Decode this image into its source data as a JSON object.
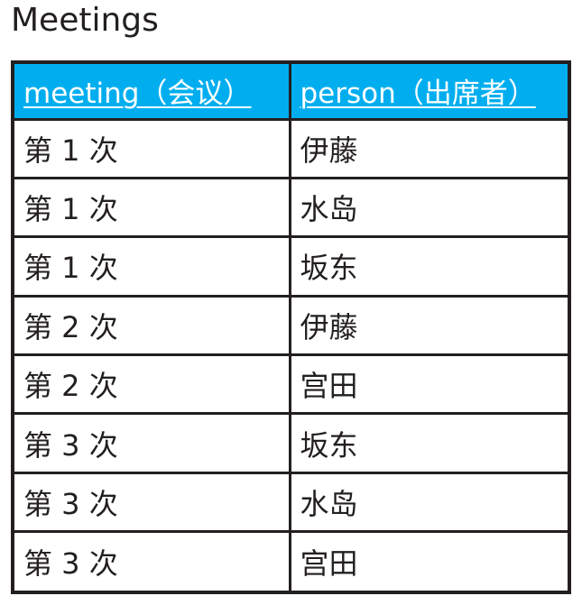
{
  "page": {
    "title": "Meetings"
  },
  "table": {
    "headers": [
      "meeting（会议）",
      "person（出席者）"
    ],
    "rows": [
      [
        "第 1 次",
        "伊藤"
      ],
      [
        "第 1 次",
        "水岛"
      ],
      [
        "第 1 次",
        "坂东"
      ],
      [
        "第 2 次",
        "伊藤"
      ],
      [
        "第 2 次",
        "宫田"
      ],
      [
        "第 3 次",
        "坂东"
      ],
      [
        "第 3 次",
        "水岛"
      ],
      [
        "第 3 次",
        "宫田"
      ]
    ]
  },
  "colors": {
    "header_background": "#00aeef",
    "header_text": "#ffffff",
    "border": "#231f20",
    "text": "#231f20"
  }
}
